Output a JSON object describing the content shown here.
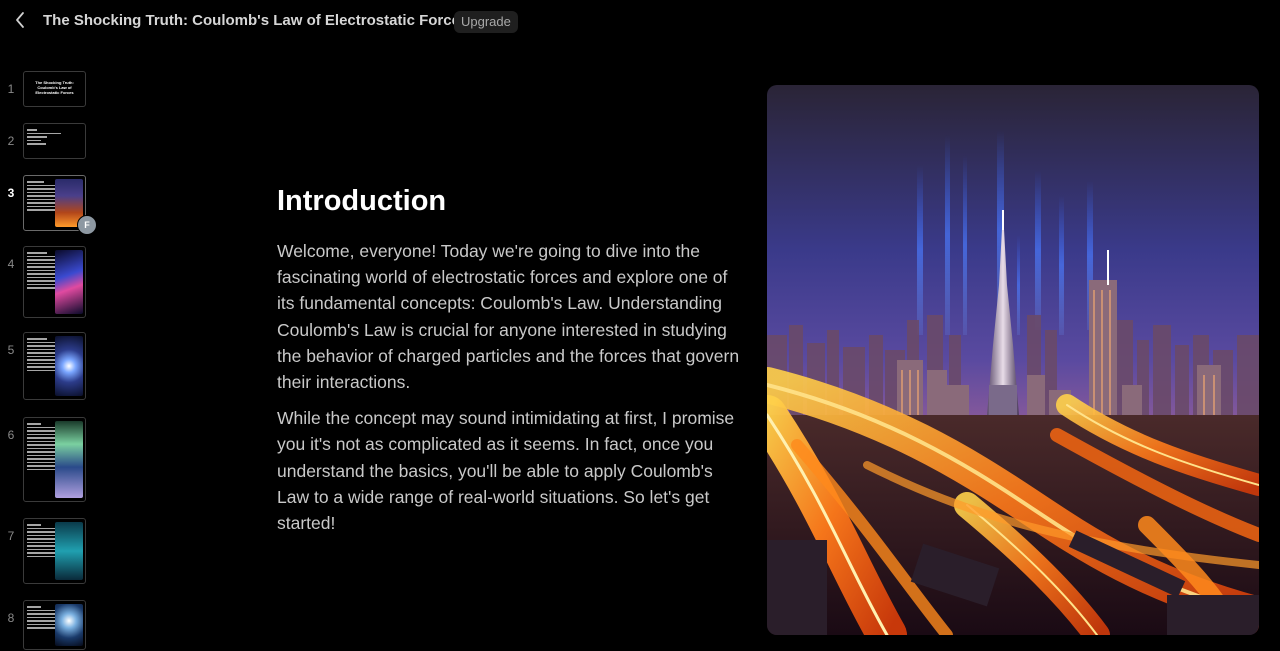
{
  "header": {
    "title": "The Shocking Truth: Coulomb's Law of Electrostatic Forces",
    "upgrade_label": "Upgrade"
  },
  "thumbnails": [
    {
      "number": "1",
      "title": "The Shocking Truth: Coulomb's Law of Electrostatic Forces"
    },
    {
      "number": "2"
    },
    {
      "number": "3",
      "active": true,
      "avatar": "F"
    },
    {
      "number": "4"
    },
    {
      "number": "5"
    },
    {
      "number": "6"
    },
    {
      "number": "7"
    },
    {
      "number": "8"
    }
  ],
  "slide": {
    "heading": "Introduction",
    "paragraph_1": "Welcome, everyone! Today we're going to dive into the fascinating world of electrostatic forces and explore one of its fundamental concepts: Coulomb's Law. Understanding Coulomb's Law is crucial for anyone interested in studying the behavior of charged particles and the forces that govern their interactions.",
    "paragraph_2": "While the concept may sound intimidating at first, I promise you it's not as complicated as it seems. In fact, once you understand the basics, you'll be able to apply Coulomb's Law to a wide range of real-world situations. So let's get started!"
  },
  "colors": {
    "background": "#000000",
    "avatar": "#8d98a2",
    "light_trail": "#ff8a1c"
  }
}
